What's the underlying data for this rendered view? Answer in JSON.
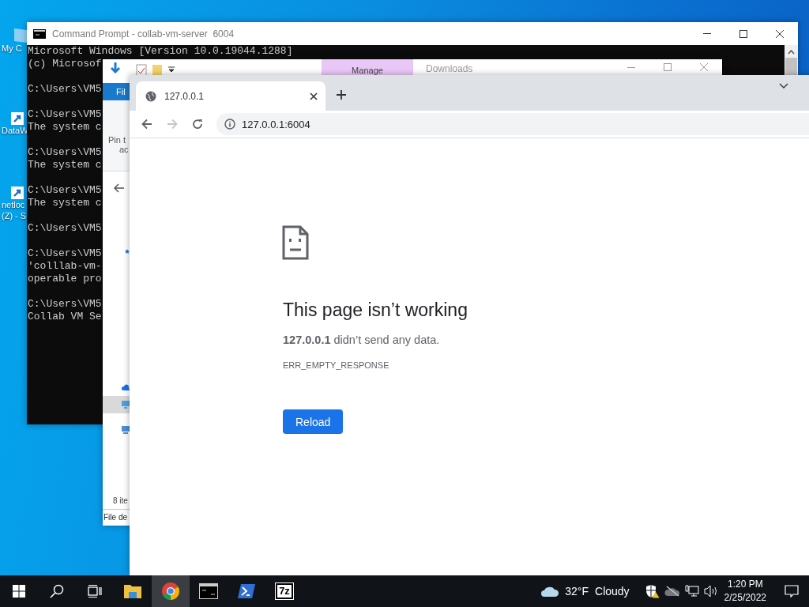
{
  "desktop_icons": [
    {
      "kind": "computer",
      "lines": [
        "My C"
      ]
    },
    {
      "kind": "shortcut",
      "lines": [
        "DataW"
      ]
    },
    {
      "kind": "drive",
      "lines": [
        "netloc",
        "(Z) - S"
      ]
    }
  ],
  "cmd": {
    "title": "Command Prompt - collab-vm-server  6004",
    "blocks": [
      [
        "Microsoft Windows [Version 10.0.19044.1288]",
        "(c) Microsof"
      ],
      [
        "C:\\Users\\VM5"
      ],
      [
        "C:\\Users\\VM5",
        "The system c"
      ],
      [
        "C:\\Users\\VM5",
        "The system c"
      ],
      [
        "C:\\Users\\VM5",
        "The system c"
      ],
      [
        "C:\\Users\\VM5"
      ],
      [
        "C:\\Users\\VM5",
        "'colllab-vm-",
        "operable pro"
      ],
      [
        "C:\\Users\\VM5",
        "Collab VM Se"
      ]
    ]
  },
  "explorer": {
    "context_tab": "Manage",
    "title": "Downloads",
    "file_tab": "Fil",
    "pin_lines": [
      "Pin t",
      "ac"
    ],
    "status": "8 ite",
    "details": "File de"
  },
  "chrome": {
    "tabs": [
      {
        "title": "127.0.0.1",
        "selected": true
      }
    ],
    "url": "127.0.0.1:6004",
    "error": {
      "title": "This page isn’t working",
      "message": "**127.0.0.1** didn’t send any data.",
      "code": "ERR_EMPTY_RESPONSE",
      "button": "Reload"
    }
  },
  "taskbar": {
    "apps": [
      {
        "kind": "explorer",
        "selected": false
      },
      {
        "kind": "chrome",
        "selected": true
      },
      {
        "kind": "terminal",
        "selected": false
      },
      {
        "kind": "powershell",
        "selected": false
      },
      {
        "kind": "archive",
        "selected": false,
        "label": "7z"
      }
    ],
    "weather": {
      "temperature": "32°F",
      "condition": "Cloudy"
    },
    "time": "1:20 PM",
    "date": "2/25/2022"
  }
}
